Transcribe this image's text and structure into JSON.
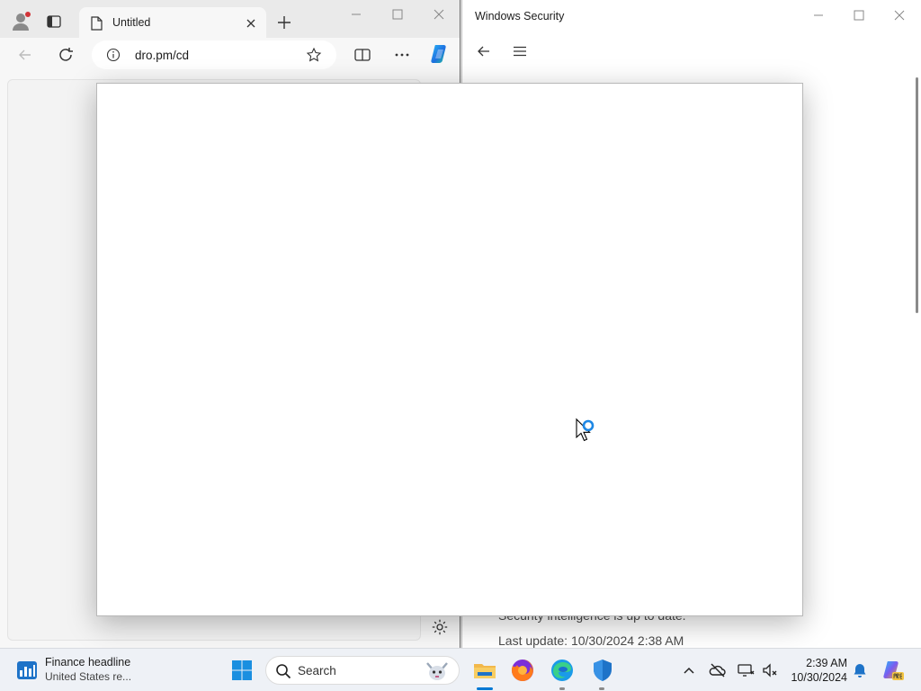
{
  "browser": {
    "tab_title": "Untitled",
    "address": "dro.pm/cd",
    "icons": [
      "profile-icon",
      "tab-actions-icon",
      "page-icon",
      "close-icon",
      "new-tab-icon",
      "back-icon",
      "refresh-icon",
      "info-icon",
      "favorite-star-icon",
      "split-screen-icon",
      "more-icon",
      "copilot-icon",
      "settings-icon"
    ]
  },
  "security_window": {
    "title": "Windows Security",
    "status_text": "Security intelligence is up to date.",
    "last_update": "Last update: 10/30/2024 2:38 AM"
  },
  "dialog": {
    "state": "blank-loading"
  },
  "taskbar": {
    "widget_title": "Finance headline",
    "widget_subtitle": "United States re...",
    "search_placeholder": "Search",
    "apps": [
      "file-explorer-icon",
      "firefox-icon",
      "edge-icon",
      "windows-security-icon"
    ],
    "tray_icons": [
      "chevron-up-icon",
      "onedrive-icon",
      "network-icon",
      "volume-icon",
      "notification-bell-icon",
      "copilot-pre-icon"
    ],
    "time": "2:39 AM",
    "date": "10/30/2024"
  },
  "colors": {
    "accent": "#0078d4",
    "taskbar": "#eef1f6",
    "browser_chrome": "#eaeaea"
  }
}
